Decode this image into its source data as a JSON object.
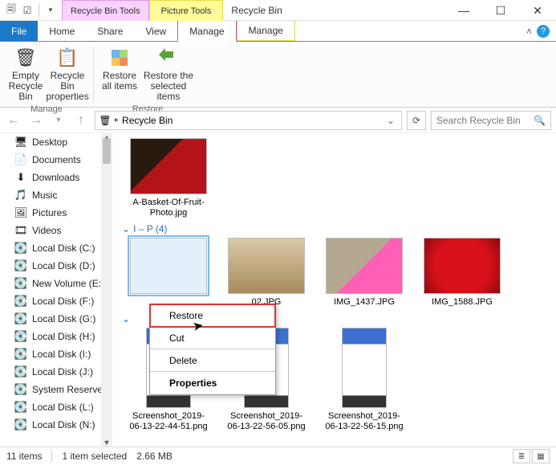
{
  "title": "Recycle Bin",
  "tabgroups": {
    "bin": "Recycle Bin Tools",
    "pic": "Picture Tools"
  },
  "ribtabs": {
    "file": "File",
    "home": "Home",
    "share": "Share",
    "view": "View",
    "manage1": "Manage",
    "manage2": "Manage"
  },
  "ribbon": {
    "empty": "Empty Recycle Bin",
    "props": "Recycle Bin properties",
    "restore_all": "Restore all items",
    "restore_sel": "Restore the selected items",
    "grp_manage": "Manage",
    "grp_restore": "Restore"
  },
  "address": {
    "crumb": "Recycle Bin",
    "search_ph": "Search Recycle Bin"
  },
  "tree": [
    {
      "icon": "🖥",
      "label": "Desktop"
    },
    {
      "icon": "📄",
      "label": "Documents"
    },
    {
      "icon": "⬇",
      "label": "Downloads"
    },
    {
      "icon": "🎵",
      "label": "Music"
    },
    {
      "icon": "🖼",
      "label": "Pictures"
    },
    {
      "icon": "🎞",
      "label": "Videos"
    },
    {
      "icon": "💽",
      "label": "Local Disk (C:)"
    },
    {
      "icon": "💽",
      "label": "Local Disk (D:)"
    },
    {
      "icon": "💽",
      "label": "New Volume (E:)"
    },
    {
      "icon": "💽",
      "label": "Local Disk (F:)"
    },
    {
      "icon": "💽",
      "label": "Local Disk (G:)"
    },
    {
      "icon": "💽",
      "label": "Local Disk (H:)"
    },
    {
      "icon": "💽",
      "label": "Local Disk (I:)"
    },
    {
      "icon": "💽",
      "label": "Local Disk (J:)"
    },
    {
      "icon": "💽",
      "label": "System Reservec"
    },
    {
      "icon": "💽",
      "label": "Local Disk (L:)"
    },
    {
      "icon": "💽",
      "label": "Local Disk (N:)"
    }
  ],
  "groups": [
    {
      "header": "",
      "items": [
        {
          "cls": "th-fruit",
          "name": "A-Basket-Of-Fruit-Photo.jpg"
        }
      ]
    },
    {
      "header": "I – P (4)",
      "items": [
        {
          "cls": "th-cat",
          "name": "",
          "sel": true
        },
        {
          "cls": "th-dog",
          "name": "02.JPG"
        },
        {
          "cls": "th-cat2",
          "name": "IMG_1437.JPG"
        },
        {
          "cls": "th-straw",
          "name": "IMG_1588.JPG"
        }
      ]
    },
    {
      "header": "",
      "items": [
        {
          "cls": "th-ss",
          "name": "Screenshot_2019-06-13-22-44-51.png"
        },
        {
          "cls": "th-ss",
          "name": "Screenshot_2019-06-13-22-56-05.png"
        },
        {
          "cls": "th-ss",
          "name": "Screenshot_2019-06-13-22-56-15.png"
        }
      ]
    }
  ],
  "context": {
    "restore": "Restore",
    "cut": "Cut",
    "delete": "Delete",
    "properties": "Properties"
  },
  "status": {
    "count": "11 items",
    "sel": "1 item selected",
    "size": "2.66 MB"
  }
}
